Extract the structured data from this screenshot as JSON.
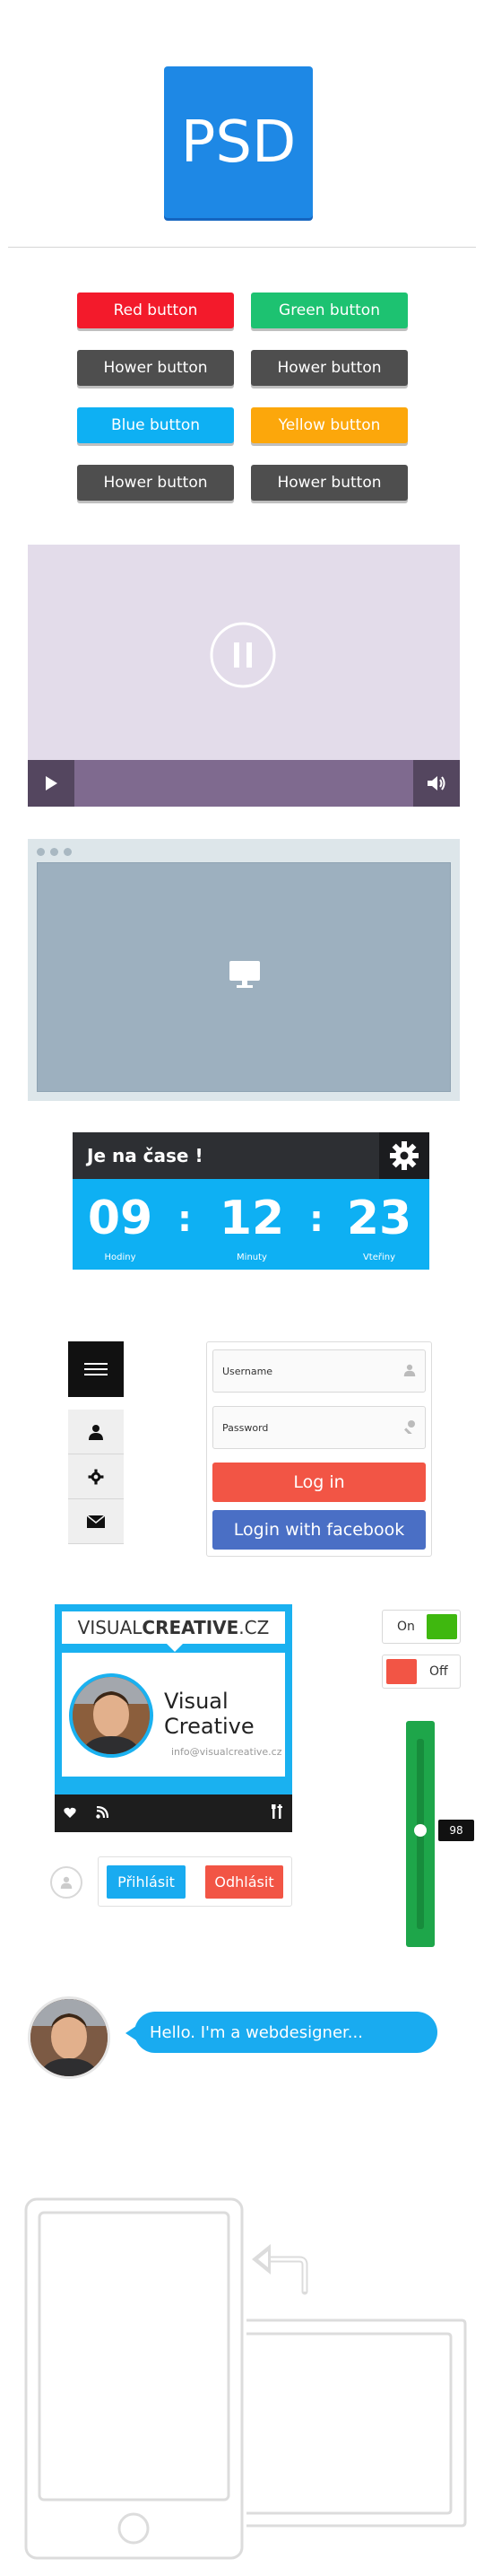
{
  "logo": {
    "text": "PSD"
  },
  "buttons": [
    {
      "label": "Red button",
      "color": "#f31a2b"
    },
    {
      "label": "Green button",
      "color": "#1dc271"
    },
    {
      "label": "Hower button",
      "color": "#4e4e4e"
    },
    {
      "label": "Hower button",
      "color": "#4e4e4e"
    },
    {
      "label": "Blue button",
      "color": "#0eb0f3"
    },
    {
      "label": "Yellow button",
      "color": "#fca70b"
    },
    {
      "label": "Hower button",
      "color": "#4e4e4e"
    },
    {
      "label": "Hower button",
      "color": "#4e4e4e"
    }
  ],
  "video": {
    "state": "paused",
    "icons": [
      "pause-icon",
      "play-icon",
      "volume-icon"
    ]
  },
  "browser": {
    "icon": "monitor-icon"
  },
  "countdown": {
    "title": "Je na čase !",
    "hours": "09",
    "hours_label": "Hodiny",
    "minutes": "12",
    "minutes_label": "Minuty",
    "seconds": "23",
    "seconds_label": "Vteřiny",
    "separator": ":"
  },
  "sidebar_menu": {
    "icons": [
      "hamburger-icon",
      "user-icon",
      "gear-icon",
      "mail-icon"
    ]
  },
  "login": {
    "username_placeholder": "Username",
    "password_placeholder": "Password",
    "login_label": "Log in",
    "facebook_label": "Login with facebook",
    "login_color": "#f25545",
    "facebook_color": "#4a6fc5"
  },
  "profile_card": {
    "brand_light": "VISUAL",
    "brand_bold": "CREATIVE",
    "brand_suffix": ".CZ",
    "name_line1": "Visual",
    "name_line2": "Creative",
    "email": "info@visualcreative.cz",
    "footer_icons": [
      "heart-icon",
      "rss-icon",
      "tools-icon"
    ]
  },
  "toggles": {
    "on_label": "On",
    "off_label": "Off",
    "on_color": "#3fb80f",
    "off_color": "#f25545"
  },
  "vertical_slider": {
    "value": "98",
    "fraction": 0.52
  },
  "signin_bar": {
    "signin_label": "Přihlásit",
    "signout_label": "Odhlásit"
  },
  "chat": {
    "message": "Hello. I'm a webdesigner..."
  },
  "devices": {
    "icons": [
      "phone-outline-icon",
      "rotate-arrow-icon",
      "tablet-outline-icon"
    ]
  }
}
